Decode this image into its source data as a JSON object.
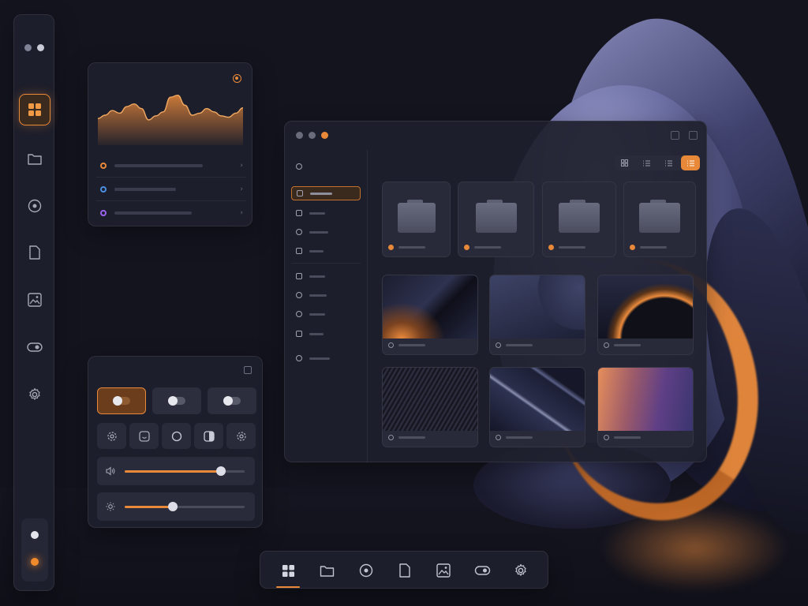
{
  "sidebar": {
    "items": [
      {
        "icon": "grid-icon",
        "active": true
      },
      {
        "icon": "folder-icon",
        "active": false
      },
      {
        "icon": "disc-icon",
        "active": false
      },
      {
        "icon": "document-icon",
        "active": false
      },
      {
        "icon": "image-icon",
        "active": false
      },
      {
        "icon": "toggle-icon",
        "active": false
      },
      {
        "icon": "gear-icon",
        "active": false
      }
    ]
  },
  "chart_card": {
    "rows": [
      {
        "color": "#e8893a"
      },
      {
        "color": "#4a8fe0"
      },
      {
        "color": "#9a63f0"
      }
    ]
  },
  "chart_data": {
    "type": "area",
    "x": [
      0,
      1,
      2,
      3,
      4,
      5,
      6,
      7,
      8,
      9,
      10,
      11,
      12,
      13,
      14,
      15,
      16,
      17,
      18,
      19,
      20
    ],
    "values": [
      40,
      45,
      52,
      48,
      58,
      62,
      55,
      38,
      44,
      50,
      72,
      75,
      60,
      45,
      48,
      55,
      50,
      44,
      42,
      48,
      56
    ],
    "color": "#e8893a",
    "ylim": [
      0,
      90
    ],
    "grid": false,
    "legend": "none"
  },
  "controls": {
    "toggles": [
      {
        "on": true
      },
      {
        "on": false
      },
      {
        "on": false
      }
    ],
    "icon_buttons": [
      "gear-icon",
      "smile-icon",
      "circle-icon",
      "contrast-icon",
      "settings-icon"
    ],
    "volume": {
      "icon": "volume-icon",
      "value": 0.8
    },
    "brightness": {
      "icon": "brightness-icon",
      "value": 0.4
    }
  },
  "window": {
    "folders": [
      {
        "dot": "#e8893a"
      },
      {
        "dot": "#e8893a"
      },
      {
        "dot": "#e8893a"
      },
      {
        "dot": "#e8893a"
      }
    ],
    "view_modes": [
      "grid-view-icon",
      "list-view-icon",
      "detail-view-icon",
      "compact-list-icon"
    ],
    "active_view": 3
  },
  "dock": {
    "items": [
      "grid-icon",
      "folder-icon",
      "disc-icon",
      "document-icon",
      "image-icon",
      "toggle-icon",
      "gear-icon"
    ],
    "active": 0
  },
  "colors": {
    "accent": "#e8893a",
    "background": "#14141f",
    "panel": "#1e1f2c"
  }
}
